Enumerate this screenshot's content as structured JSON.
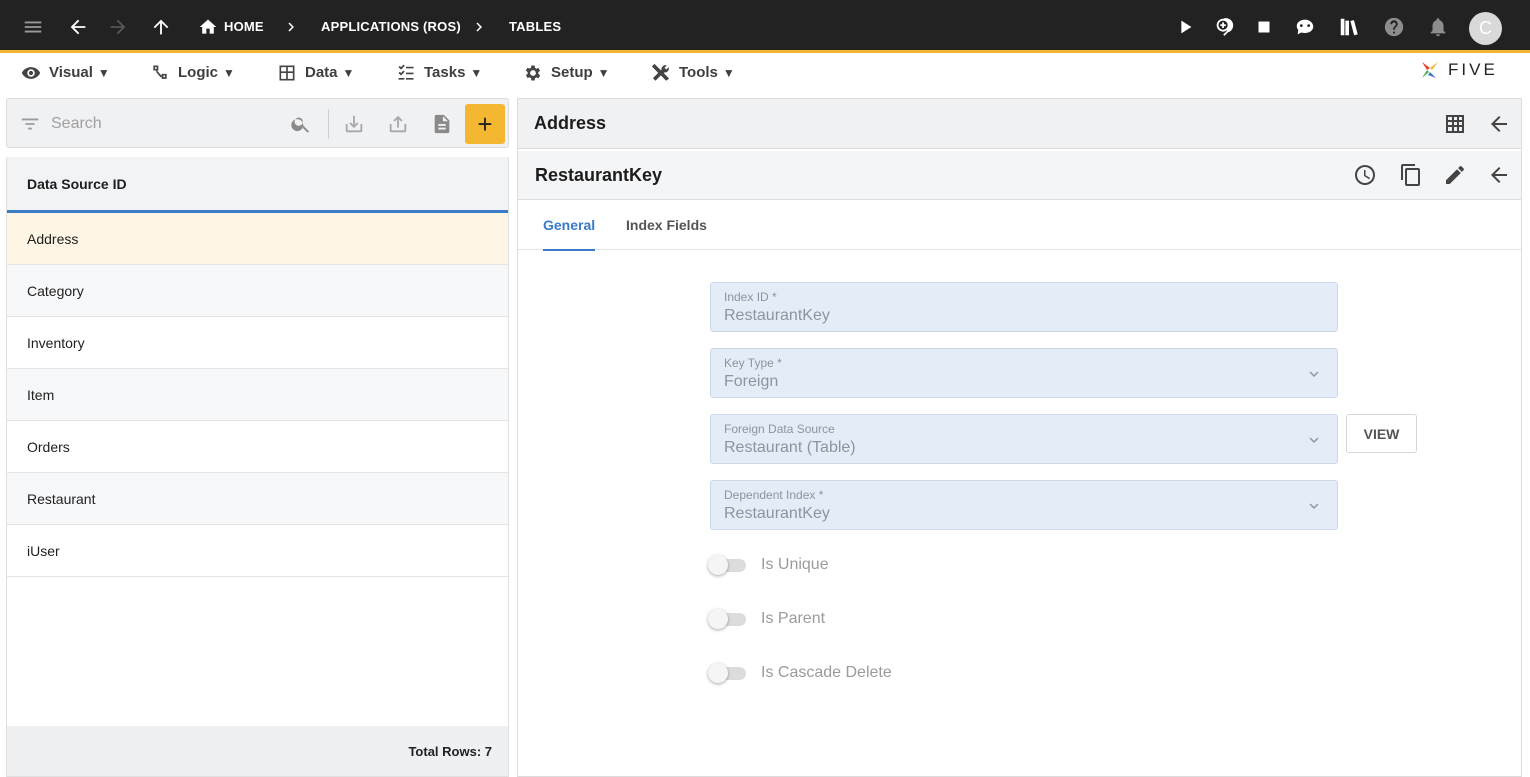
{
  "topbar": {
    "breadcrumbs": [
      {
        "label": "HOME"
      },
      {
        "label": "APPLICATIONS (ROS)"
      },
      {
        "label": "TABLES"
      }
    ],
    "avatar_initial": "C"
  },
  "menubar": {
    "items": [
      {
        "label": "Visual",
        "icon": "eye-icon"
      },
      {
        "label": "Logic",
        "icon": "logic-icon"
      },
      {
        "label": "Data",
        "icon": "table-icon"
      },
      {
        "label": "Tasks",
        "icon": "checklist-icon"
      },
      {
        "label": "Setup",
        "icon": "gear-icon"
      },
      {
        "label": "Tools",
        "icon": "tools-icon"
      }
    ],
    "logo_text": "FIVE"
  },
  "left_panel": {
    "search_placeholder": "Search",
    "column_header": "Data Source ID",
    "rows": [
      "Address",
      "Category",
      "Inventory",
      "Item",
      "Orders",
      "Restaurant",
      "iUser"
    ],
    "footer": "Total Rows: 7"
  },
  "right_panel": {
    "title": "Address",
    "record_title": "RestaurantKey",
    "tabs": [
      "General",
      "Index Fields"
    ],
    "fields": {
      "index_id": {
        "label": "Index ID *",
        "value": "RestaurantKey"
      },
      "key_type": {
        "label": "Key Type *",
        "value": "Foreign"
      },
      "foreign_data_source": {
        "label": "Foreign Data Source",
        "value": "Restaurant (Table)"
      },
      "dependent_index": {
        "label": "Dependent Index *",
        "value": "RestaurantKey"
      }
    },
    "view_button": "VIEW",
    "toggles": {
      "is_unique": {
        "label": "Is Unique",
        "checked": false
      },
      "is_parent": {
        "label": "Is Parent",
        "checked": false
      },
      "is_cascade_delete": {
        "label": "Is Cascade Delete",
        "checked": false
      }
    }
  },
  "colors": {
    "topbar_bg": "#222222",
    "accent": "#f4b731",
    "link_blue": "#3a7bc8",
    "selected_row": "#fef5e4",
    "field_bg": "#e4edf7"
  }
}
